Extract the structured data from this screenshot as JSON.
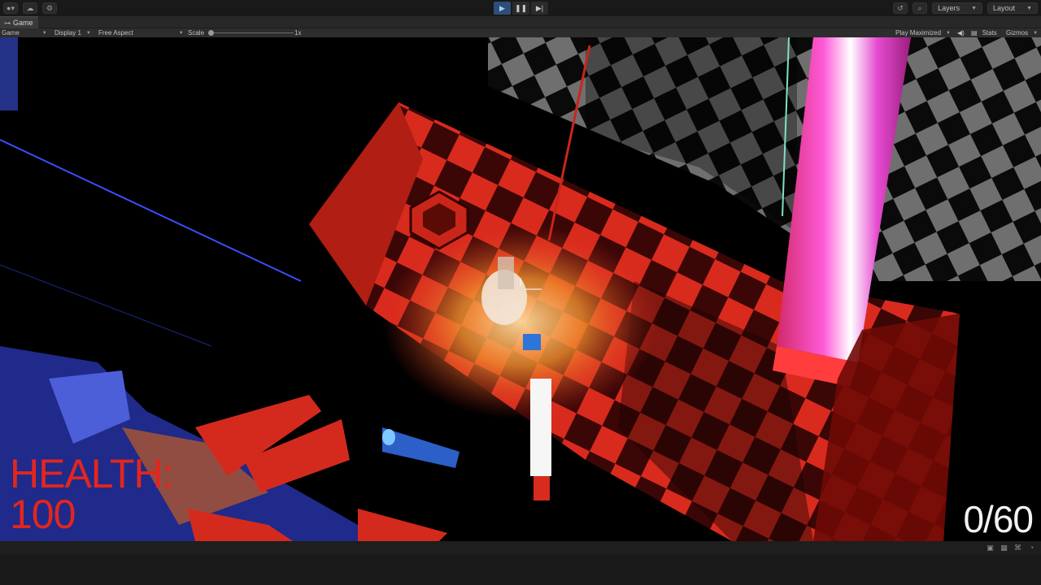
{
  "toolbar": {
    "left_buttons": [
      "account-icon",
      "cloud-icon",
      "services-icon"
    ],
    "play_controls": [
      "play-icon",
      "pause-icon",
      "step-icon"
    ],
    "history_icon": "history-icon",
    "search_icon": "search-icon",
    "layers_label": "Layers",
    "layout_label": "Layout"
  },
  "tab": {
    "icon": "gamepad-icon",
    "label": "Game"
  },
  "game_controls": {
    "mode": "Game",
    "display": "Display 1",
    "aspect": "Free Aspect",
    "scale_label": "Scale",
    "scale_value": "1x",
    "play_mode": "Play Maximized",
    "stats_label": "Stats",
    "gizmos_label": "Gizmos"
  },
  "hud": {
    "health_label": "HEALTH:",
    "health_value": "100",
    "ammo": "0/60"
  },
  "colors": {
    "health_text": "#e3261d",
    "ammo_text": "#f2f2f2",
    "play_active": "#2e4d78"
  }
}
